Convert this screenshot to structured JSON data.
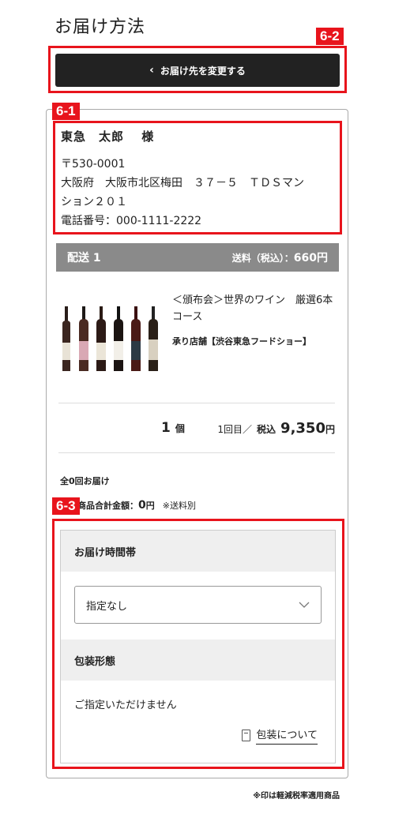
{
  "page": {
    "title": "お届け方法"
  },
  "tags": {
    "t62": "6-2",
    "t61": "6-1",
    "t63": "6-3"
  },
  "change_button": {
    "label": "お届け先を変更する"
  },
  "address": {
    "name": "東急　太郎　 様",
    "postal": "〒530-0001",
    "line1": "大阪府　大阪市北区梅田　３７－５　ＴＤＳマン",
    "line2": "ション２０１",
    "phone": "電話番号：000-1111-2222"
  },
  "shipment": {
    "label": "配送 1",
    "fee_label": "送料（税込）：",
    "fee_value": "660円"
  },
  "product": {
    "title": "＜頒布会＞世界のワイン　厳選6本コース",
    "shop": "承り店舗【渋谷東急フードショー】",
    "quantity": "1",
    "quantity_unit": "個",
    "order_label": "1回目／",
    "tax_label": "税込",
    "price": "9,350",
    "yen": "円"
  },
  "totals": {
    "count": "全0回お届け",
    "amount_label": "回の商品合計金額：",
    "amount": "0",
    "amount_unit": "円",
    "shipping_note": "※送料別"
  },
  "options": {
    "time_label": "お届け時間帯",
    "time_selected": "指定なし",
    "wrap_label": "包装形態",
    "wrap_note": "ご指定いただけません",
    "wrap_link": "包装について"
  },
  "footnote": "※印は軽減税率適用商品",
  "colors": {
    "accent_red": "#e8141c",
    "button_dark": "#222222",
    "ship_bar": "#8a8a8a"
  }
}
